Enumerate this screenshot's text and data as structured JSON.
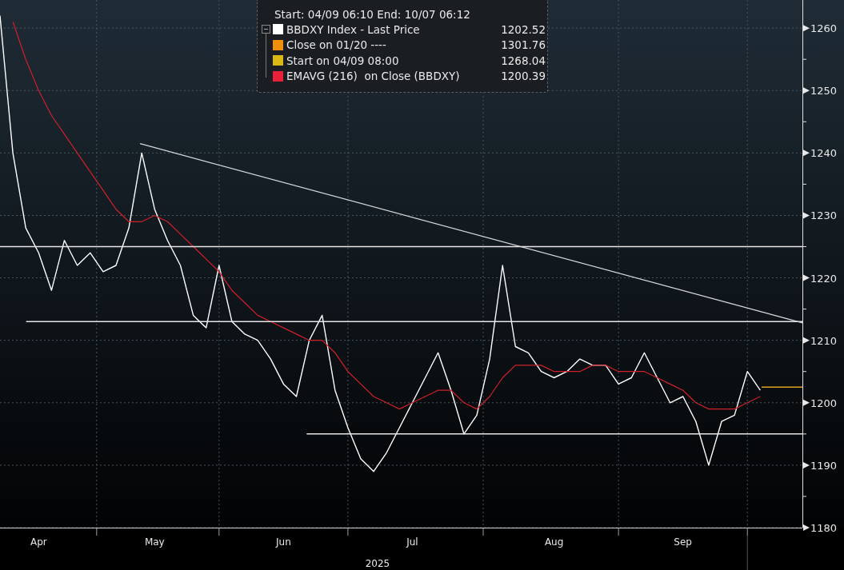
{
  "legend": {
    "range": "Start: 04/09 06:10 End: 10/07 06:12",
    "items": [
      {
        "label": "BBDXY Index - Last Price",
        "value": "1202.52",
        "color": "#ffffff"
      },
      {
        "label": "Close on 01/20 ----",
        "value": "1301.76",
        "color": "#f0900a"
      },
      {
        "label": "Start on 04/09 08:00",
        "value": "1268.04",
        "color": "#d9b814"
      },
      {
        "label": "EMAVG (216)  on Close (BBDXY)",
        "value": "1200.39",
        "color": "#e8203a"
      }
    ]
  },
  "chart": {
    "chart_data": {
      "type": "line",
      "xlabel": "2025",
      "grid": true,
      "ref_lines": [
        {
          "axis": "y",
          "value": 1225,
          "color": "#e6e6e6"
        },
        {
          "axis": "y",
          "value": 1213,
          "color": "#e6e6e6"
        },
        {
          "axis": "y",
          "value": 1195,
          "color": "#e6e6e6"
        }
      ],
      "categories": [
        null,
        null,
        null,
        "Apr",
        null,
        null,
        null,
        null,
        null,
        null,
        null,
        null,
        "May",
        null,
        null,
        null,
        null,
        null,
        null,
        null,
        null,
        null,
        "Jun",
        null,
        null,
        null,
        null,
        null,
        null,
        null,
        null,
        null,
        "Jul",
        null,
        null,
        null,
        null,
        null,
        null,
        null,
        null,
        null,
        null,
        "Aug",
        null,
        null,
        null,
        null,
        null,
        null,
        null,
        null,
        null,
        "Sep",
        null,
        null,
        null,
        null,
        null,
        null
      ],
      "series": [
        {
          "color": "#ffffff",
          "values": [
            1262,
            1240,
            1228,
            1224,
            1218,
            1226,
            1222,
            1224,
            1221,
            1222,
            1228,
            1240,
            1231,
            1226,
            1222,
            1214,
            1212,
            1222,
            1213,
            1211,
            1210,
            1207,
            1203,
            1201,
            1210,
            1214,
            1202,
            1196,
            1191,
            1189,
            1192,
            1196,
            1200,
            1204,
            1208,
            1202,
            1195,
            1198,
            1207,
            1222,
            1209,
            1208,
            1205,
            1204,
            1205,
            1207,
            1206,
            1206,
            1203,
            1204,
            1208,
            1204,
            1200,
            1201,
            1197,
            1190,
            1197,
            1198,
            1205,
            1202
          ]
        },
        {
          "color": "#d0202a",
          "values": [
            null,
            1261,
            1255,
            1250,
            1246,
            1243,
            1240,
            1237,
            1234,
            1231,
            1229,
            1229,
            1230,
            1229,
            1227,
            1225,
            1223,
            1221,
            1218,
            1216,
            1214,
            1213,
            1212,
            1211,
            1210,
            1210,
            1208,
            1205,
            1203,
            1201,
            1200,
            1199,
            1200,
            1201,
            1202,
            1202,
            1200,
            1199,
            1201,
            1204,
            1206,
            1206,
            1206,
            1205,
            1205,
            1205,
            1206,
            1206,
            1205,
            1205,
            1205,
            1204,
            1203,
            1202,
            1200,
            1199,
            1199,
            1199,
            1200,
            1201
          ]
        }
      ],
      "ylim": [
        1180,
        1264.5
      ],
      "yticks": [
        1180,
        1190,
        1200,
        1210,
        1220,
        1230,
        1240,
        1250,
        1260
      ]
    }
  }
}
